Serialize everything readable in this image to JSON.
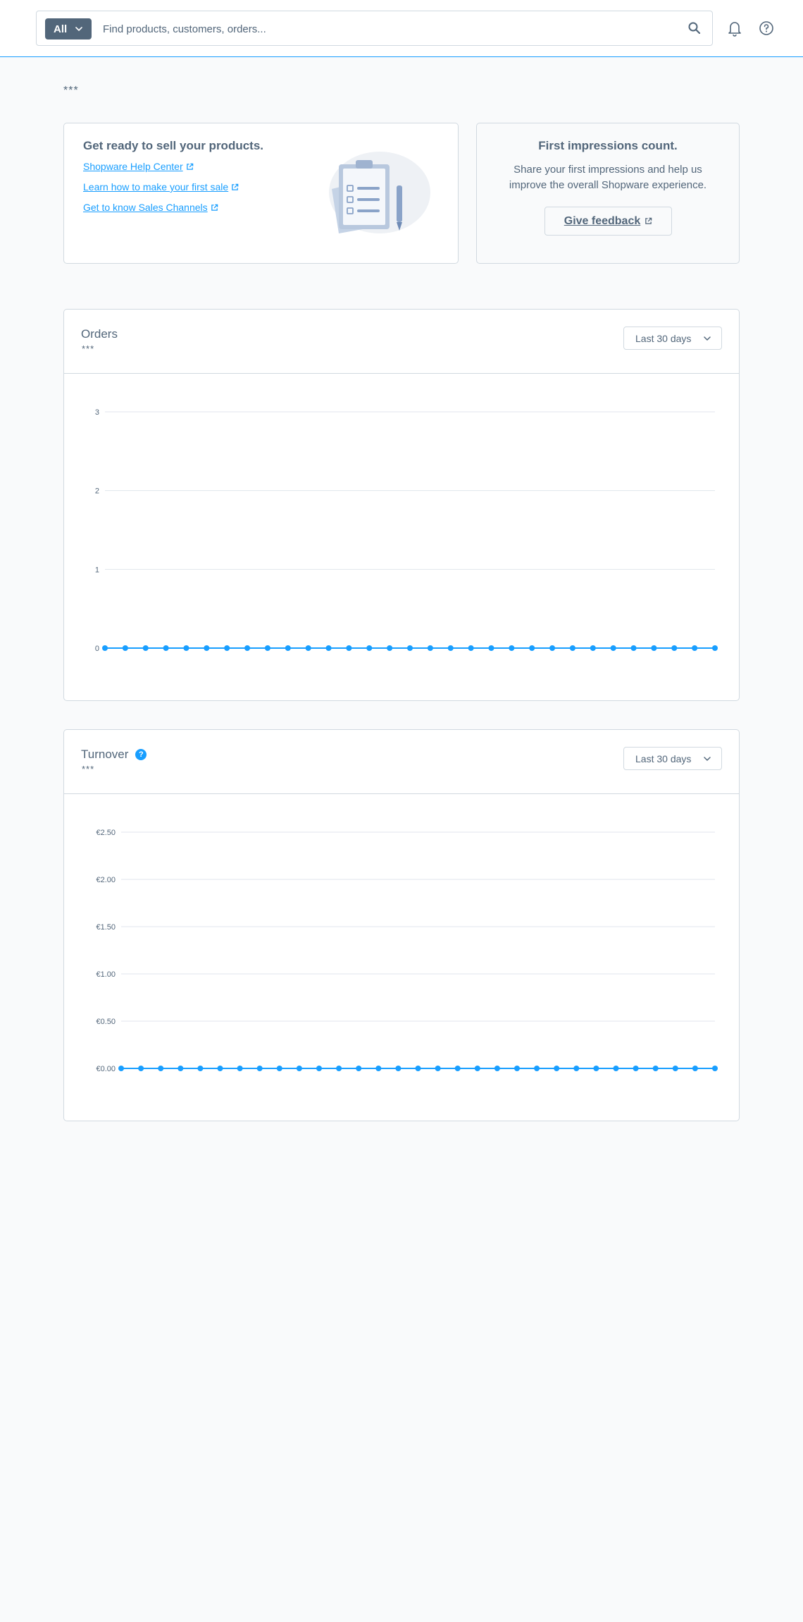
{
  "header": {
    "search_type_label": "All",
    "search_placeholder": "Find products, customers, orders..."
  },
  "page_stars": "***",
  "onboarding": {
    "title": "Get ready to sell your products.",
    "links": [
      "Shopware Help Center",
      "Learn how to make your first sale",
      "Get to know Sales Channels"
    ]
  },
  "feedback": {
    "title": "First impressions count.",
    "text": "Share your first impressions and help us improve the overall Shopware experience.",
    "button_label": "Give feedback"
  },
  "orders": {
    "title": "Orders",
    "subtitle": "***",
    "range_label": "Last 30 days"
  },
  "turnover": {
    "title": "Turnover",
    "subtitle": "***",
    "range_label": "Last 30 days",
    "info_icon_label": "?"
  },
  "colors": {
    "accent": "#189eff",
    "text": "#52667a",
    "border": "#d1d9e0"
  },
  "chart_data": [
    {
      "type": "line",
      "title": "Orders",
      "ylim": [
        0,
        3
      ],
      "yticks": [
        "0",
        "1",
        "2",
        "3"
      ],
      "x_count": 31,
      "series": [
        {
          "values": [
            0,
            0,
            0,
            0,
            0,
            0,
            0,
            0,
            0,
            0,
            0,
            0,
            0,
            0,
            0,
            0,
            0,
            0,
            0,
            0,
            0,
            0,
            0,
            0,
            0,
            0,
            0,
            0,
            0,
            0,
            0
          ]
        }
      ],
      "grid": true
    },
    {
      "type": "line",
      "title": "Turnover",
      "ylim": [
        0,
        2.5
      ],
      "yticks": [
        "€0.00",
        "€0.50",
        "€1.00",
        "€1.50",
        "€2.00",
        "€2.50"
      ],
      "x_count": 31,
      "series": [
        {
          "values": [
            0,
            0,
            0,
            0,
            0,
            0,
            0,
            0,
            0,
            0,
            0,
            0,
            0,
            0,
            0,
            0,
            0,
            0,
            0,
            0,
            0,
            0,
            0,
            0,
            0,
            0,
            0,
            0,
            0,
            0,
            0
          ]
        }
      ],
      "grid": true
    }
  ]
}
